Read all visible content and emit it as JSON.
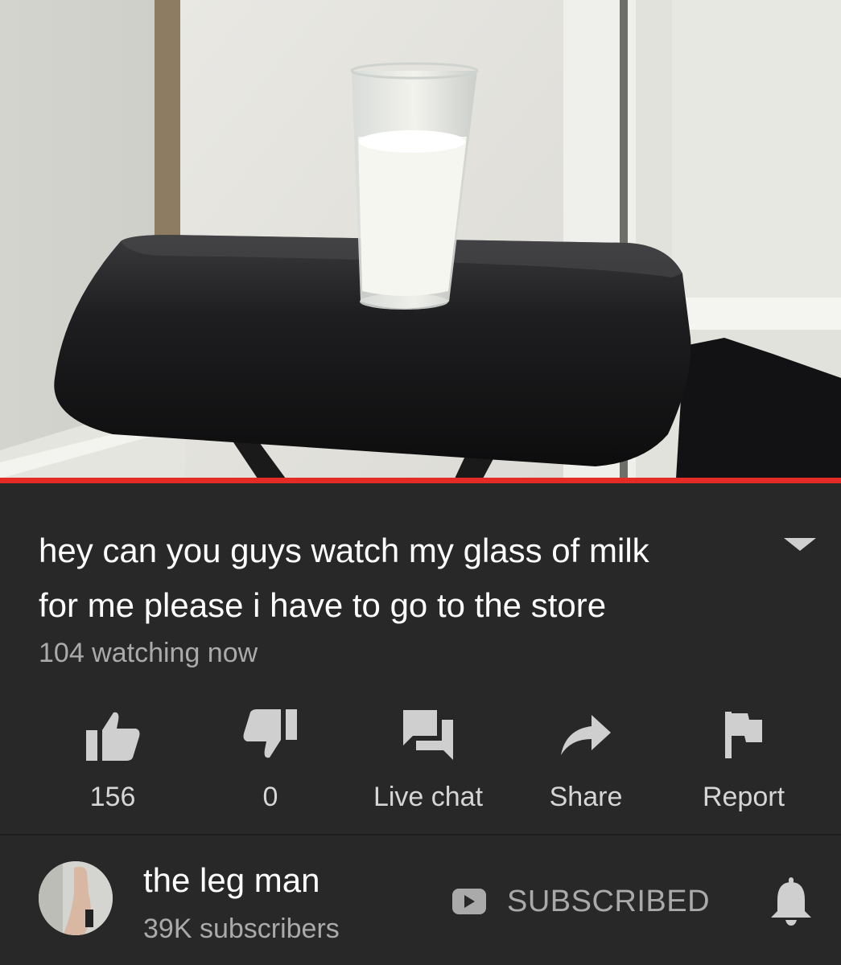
{
  "video": {
    "progress_percent": 100
  },
  "details": {
    "title_line1": "hey can you guys watch my glass of milk",
    "title_line2": "for me please i have to go to the store",
    "viewers": "104 watching now"
  },
  "actions": {
    "like_count": "156",
    "dislike_count": "0",
    "live_chat": "Live chat",
    "share": "Share",
    "report": "Report"
  },
  "channel": {
    "name": "the leg man",
    "subscribers": "39K subscribers",
    "subscribe_state": "SUBSCRIBED"
  },
  "colors": {
    "progress": "#e52b26",
    "background": "#282828",
    "icon": "#cfcfcf"
  }
}
